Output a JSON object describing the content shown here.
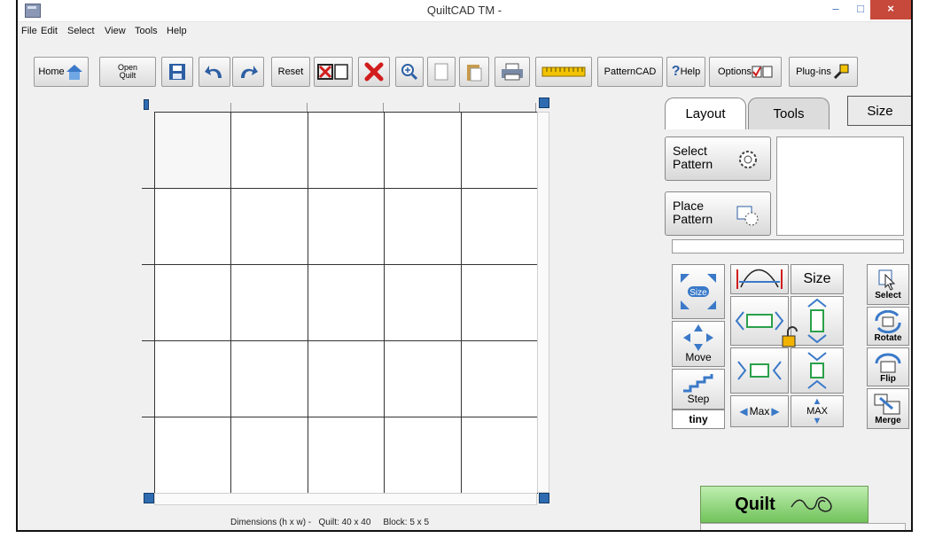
{
  "window": {
    "title": "QuiltCAD TM -",
    "controls": {
      "minimize": "–",
      "maximize": "□",
      "close": "×"
    }
  },
  "menu": [
    {
      "label": "File"
    },
    {
      "label": "Edit"
    },
    {
      "label": "Select"
    },
    {
      "label": "View"
    },
    {
      "label": "Tools"
    },
    {
      "label": "Help"
    }
  ],
  "toolbar": {
    "home": "Home",
    "open_quilt": "Open Quilt",
    "reset": "Reset",
    "patterncad": "PatternCAD",
    "help": "Help",
    "options": "Options",
    "plugins": "Plug-ins"
  },
  "canvas": {
    "dimensions_label": "Dimensions (h x w) -",
    "quilt_label": "Quilt: 40 x 40",
    "block_label": "Block: 5 x 5",
    "rows": 5,
    "cols": 5
  },
  "panel": {
    "tabs": [
      {
        "label": "Layout"
      },
      {
        "label": "Tools"
      }
    ],
    "size_button": "Size",
    "select_pattern": "Select Pattern",
    "place_pattern": "Place Pattern",
    "controls": {
      "size_icon_label": "Size",
      "size_text": "Size",
      "move": "Move",
      "step": "Step",
      "step_value": "tiny",
      "max": "Max",
      "max_caps": "MAX",
      "select": "Select",
      "rotate": "Rotate",
      "flip": "Flip",
      "merge": "Merge"
    },
    "quilt_button": "Quilt"
  }
}
